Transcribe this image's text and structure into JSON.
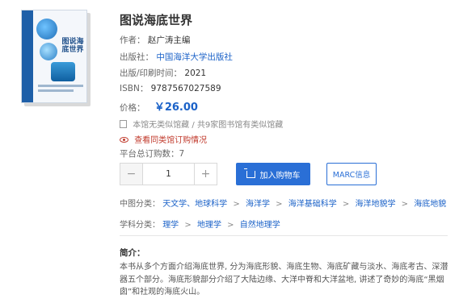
{
  "book": {
    "title": "图说海底世界",
    "cover_title": "图说海底世界",
    "author_label": "作者：",
    "author": "赵广涛主编",
    "publisher_label": "出版社：",
    "publisher": "中国海洋大学出版社",
    "year_label": "出版/印刷时间：",
    "year": "2021",
    "isbn_label": "ISBN：",
    "isbn": "9787567027589",
    "price_label": "价格：",
    "price": "￥26.00"
  },
  "holdings": {
    "local": "本馆无类似馆藏",
    "sep": "/",
    "others": "共9家图书馆有类似馆藏"
  },
  "check_orders": "查看同类馆订购情况",
  "total_orders": "平台总订购数：7",
  "stepper": {
    "minus": "−",
    "value": "1",
    "plus": "+"
  },
  "actions": {
    "cart": "加入购物车",
    "marc": "MARC信息"
  },
  "clc": {
    "label": "中图分类：",
    "items": [
      "天文学、地球科学",
      "海洋学",
      "海洋基础科学",
      "海洋地貌学",
      "海底地貌"
    ],
    "sep": ">"
  },
  "subject": {
    "label": "学科分类：",
    "items": [
      "理学",
      "地理学",
      "自然地理学"
    ],
    "sep": ">"
  },
  "summary": {
    "heading": "简介：",
    "text": "本书从多个方面介绍海底世界, 分为海底形貌、海底生物、海底矿藏与淡水、海底考古、深潜器五个部分。海底形貌部分介绍了大陆边缘、大洋中脊和大洋盆地, 讲述了奇妙的海底“黑烟囱”和社观的海底火山。"
  }
}
